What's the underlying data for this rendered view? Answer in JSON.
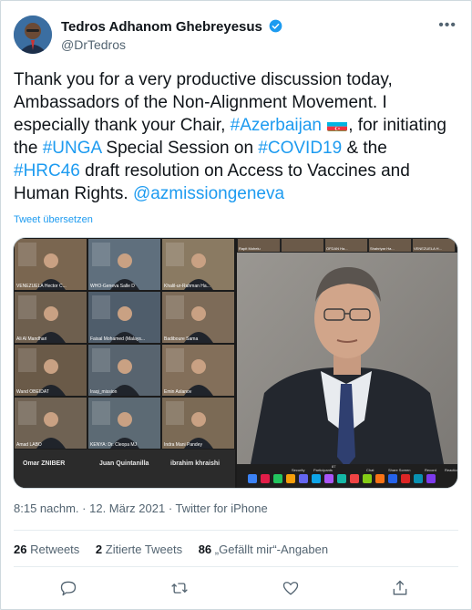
{
  "author": {
    "name": "Tedros Adhanom Ghebreyesus",
    "handle": "@DrTedros"
  },
  "more_label": "•••",
  "tweet": {
    "line1": "Thank you for a very productive discussion today,",
    "line2": "Ambassadors of the Non-Alignment Movement. I",
    "line3_a": "especially thank your Chair, ",
    "tag_azerbaijan": "#Azerbaijan",
    "line3_b": ", for initiating",
    "line4_a": "the ",
    "tag_unga": "#UNGA",
    "line4_b": " Special Session on ",
    "tag_covid": "#COVID19",
    "line4_c": " & the",
    "tag_hrc": "#HRC46",
    "line5_b": " draft resolution on Access to Vaccines and",
    "line6_a": "Human Rights. ",
    "mention": "@azmissiongeneva"
  },
  "translate_label": "Tweet übersetzen",
  "media": {
    "tile_names": [
      "VENEZUELA Hector C...",
      "WHO-Geneva Salle D",
      "Khalil-ur-Rahman Ha...",
      "Ali Al Mandhari",
      "Faisal Mohamed (Malays...",
      "Badiboure Sama",
      "Wand OBEIDAT",
      "Iraqi_mission",
      "Emin Aslanov",
      "Amad LABO",
      "KENYA: Dr. Cleopa MJ",
      "Indra Mani Pandey"
    ],
    "bottom_names": [
      "Omar ZNIBER",
      "Juan Quintanilla",
      "ibrahim khraishi"
    ],
    "strip_names": [
      "Rapit Mohelu",
      "",
      "OFDAN Ha...",
      "Shahriyar Ha...",
      "VENEZUELA H..."
    ],
    "toolbar_labels": [
      "Security",
      "Participants",
      "Chat",
      "Share Screen",
      "Record",
      "Reactions"
    ],
    "participants_count": "87"
  },
  "meta": {
    "time": "8:15 nachm.",
    "dot": " · ",
    "date": "12. März 2021",
    "source": "Twitter for iPhone"
  },
  "stats": {
    "retweets_count": "26",
    "retweets_label": "Retweets",
    "quotes_count": "2",
    "quotes_label": "Zitierte Tweets",
    "likes_count": "86",
    "likes_label": "„Gefällt mir“-Angaben"
  },
  "icons": {
    "reply": "reply-icon",
    "retweet": "retweet-icon",
    "like": "heart-icon",
    "share": "share-icon"
  },
  "colors": {
    "link": "#1d9bf0",
    "text": "#0f1419",
    "secondary": "#536471"
  }
}
